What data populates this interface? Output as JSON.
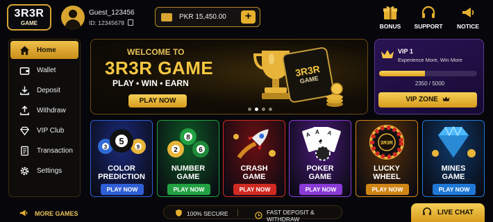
{
  "logo": {
    "line1": "3R3R",
    "line2": "GAME"
  },
  "user": {
    "name": "Guest_123456",
    "id": "ID: 12345678"
  },
  "wallet": {
    "balance": "PKR 15,450.00",
    "add_label": "+"
  },
  "top_actions": [
    {
      "label": "BONUS",
      "icon": "gift-icon"
    },
    {
      "label": "SUPPORT",
      "icon": "headset-icon"
    },
    {
      "label": "NOTICE",
      "icon": "megaphone-icon"
    }
  ],
  "sidebar": {
    "items": [
      {
        "label": "Home",
        "icon": "home-icon",
        "active": true
      },
      {
        "label": "Wallet",
        "icon": "wallet-icon"
      },
      {
        "label": "Deposit",
        "icon": "download-icon"
      },
      {
        "label": "Withdraw",
        "icon": "upload-icon"
      },
      {
        "label": "VIP Club",
        "icon": "diamond-icon"
      },
      {
        "label": "Transaction",
        "icon": "document-icon"
      },
      {
        "label": "Settings",
        "icon": "gear-icon"
      }
    ]
  },
  "banner": {
    "welcome": "WELCOME TO",
    "title": "3R3R GAME",
    "tagline": "PLAY • WIN • EARN",
    "cta": "PLAY NOW",
    "card_line1": "3R3R",
    "card_line2": "GAME",
    "slides": 4,
    "active_slide": 2
  },
  "vip": {
    "title": "VIP 1",
    "subtitle": "Experience More, Win More",
    "progress_text": "2350 / 5000",
    "progress_fraction": 0.47,
    "cta": "VIP ZONE"
  },
  "games": [
    {
      "line1": "COLOR",
      "line2": "PREDICTION",
      "play": "PLAY NOW",
      "icon": "billiard-balls-icon",
      "bg": "#1a2a7a",
      "btn": "#2f5fd6"
    },
    {
      "line1": "NUMBER",
      "line2": "GAME",
      "play": "PLAY NOW",
      "icon": "number-balls-icon",
      "bg": "#0f5a26",
      "btn": "#22a142"
    },
    {
      "line1": "CRASH",
      "line2": "GAME",
      "play": "PLAY NOW",
      "icon": "rocket-icon",
      "bg": "#6a0f12",
      "btn": "#d02a22"
    },
    {
      "line1": "POKER",
      "line2": "GAME",
      "play": "PLAY NOW",
      "icon": "cards-icon",
      "bg": "#4a1a7a",
      "btn": "#8a3ad6"
    },
    {
      "line1": "LUCKY",
      "line2": "WHEEL",
      "play": "PLAY NOW",
      "icon": "wheel-icon",
      "bg": "#5a3208",
      "btn": "#d08516",
      "wheel_text": "3R3R"
    },
    {
      "line1": "MINES",
      "line2": "GAME",
      "play": "PLAY NOW",
      "icon": "diamond-icon",
      "bg": "#0f3a6a",
      "btn": "#1f78d6"
    }
  ],
  "footer": {
    "more_games": "MORE GAMES",
    "secure": "100% SECURE",
    "fast": "FAST DEPOSIT & WITHDRAW",
    "live_chat": "LIVE CHAT"
  },
  "colors": {
    "gold": "#e6b02e",
    "bg": "#07070b"
  }
}
